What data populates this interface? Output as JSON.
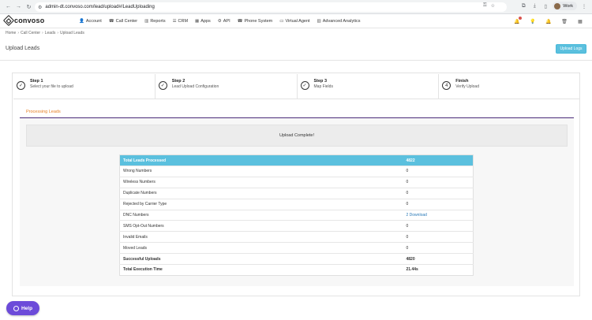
{
  "browser": {
    "url": "admin-dt.convoso.com/lead/upload#/LeadUploading",
    "profile_label": "Work"
  },
  "app": {
    "logo_text": "convoso",
    "menu": [
      {
        "label": "Account",
        "icon": "user-icon"
      },
      {
        "label": "Call Center",
        "icon": "phone-icon"
      },
      {
        "label": "Reports",
        "icon": "bar-chart-icon"
      },
      {
        "label": "CRM",
        "icon": "list-icon"
      },
      {
        "label": "Apps",
        "icon": "grid-icon"
      },
      {
        "label": "API",
        "icon": "gear-icon"
      },
      {
        "label": "Phone System",
        "icon": "phone-icon"
      },
      {
        "label": "Virtual Agent",
        "icon": "monitor-icon"
      },
      {
        "label": "Advanced Analytics",
        "icon": "bar-chart-icon"
      }
    ]
  },
  "breadcrumb": [
    "Home",
    "Call Center",
    "Leads",
    "Upload Leads"
  ],
  "page": {
    "title": "Upload Leads",
    "logs_button": "Upload Logs"
  },
  "wizard": [
    {
      "title": "Step 1",
      "desc": "Select your file to upload",
      "status": "done"
    },
    {
      "title": "Step 2",
      "desc": "Lead Upload Configuration",
      "status": "done"
    },
    {
      "title": "Step 3",
      "desc": "Map Fields",
      "status": "done"
    },
    {
      "title": "Finish",
      "desc": "Verify Upload",
      "status": "4"
    }
  ],
  "processing": {
    "tab_label": "Processing Leads",
    "complete_message": "Upload Complete!"
  },
  "results": {
    "rows": [
      {
        "label": "Total Leads Processed",
        "value": "4822",
        "style": "head"
      },
      {
        "label": "Wrong Numbers",
        "value": "0"
      },
      {
        "label": "Wireless Numbers",
        "value": "0"
      },
      {
        "label": "Duplicate Numbers",
        "value": "0"
      },
      {
        "label": "Rejected by Carrier Type",
        "value": "0"
      },
      {
        "label": "DNC Numbers",
        "value": "2 Download",
        "link": true
      },
      {
        "label": "SMS Opt-Out Numbers",
        "value": "0"
      },
      {
        "label": "Invalid Emails",
        "value": "0"
      },
      {
        "label": "Moved Leads",
        "value": "0"
      },
      {
        "label": "Successful Uploads",
        "value": "4820",
        "style": "bold"
      },
      {
        "label": "Total Execution Time",
        "value": "21.44s",
        "style": "bold"
      }
    ]
  },
  "help": {
    "label": "Help"
  },
  "colors": {
    "accent": "#5bc0de",
    "tab_text": "#e67e22",
    "tab_underline": "#4b2c7a",
    "help_bg": "#6c4bd9"
  }
}
